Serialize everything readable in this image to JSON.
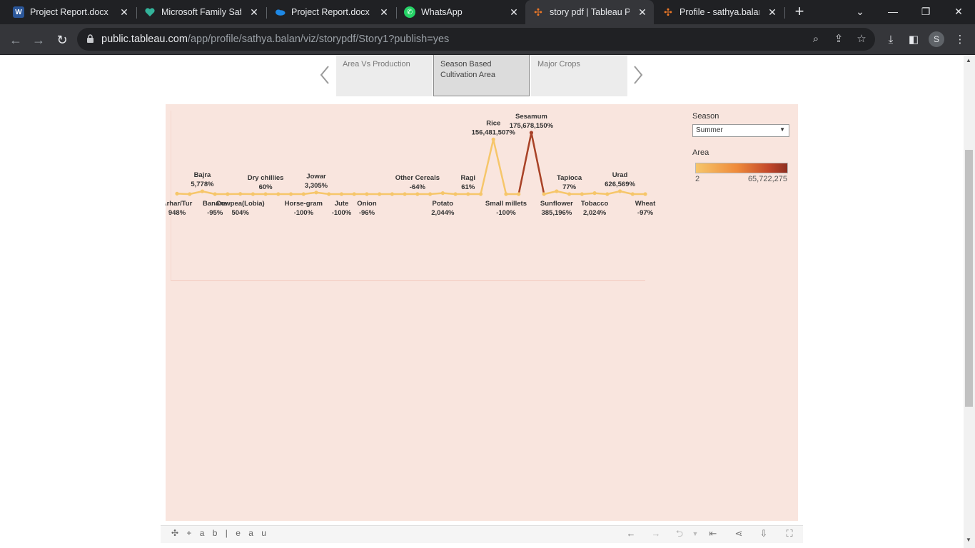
{
  "browser": {
    "tabs": [
      {
        "title": "Project Report.docx -",
        "icon": "word-icon",
        "active": false
      },
      {
        "title": "Microsoft Family Safe",
        "icon": "family-safety-icon",
        "active": false
      },
      {
        "title": "Project Report.docx -",
        "icon": "onedrive-icon",
        "active": false
      },
      {
        "title": "WhatsApp",
        "icon": "whatsapp-icon",
        "active": false
      },
      {
        "title": "story pdf | Tableau Pu",
        "icon": "tableau-icon",
        "active": true
      },
      {
        "title": "Profile - sathya.balan",
        "icon": "tableau-icon",
        "active": false
      }
    ],
    "url_host": "public.tableau.com",
    "url_path": "/app/profile/sathya.balan/viz/storypdf/Story1?publish=yes",
    "profile_initial": "S"
  },
  "story": {
    "tabs": [
      {
        "label": "Area Vs Production",
        "selected": false
      },
      {
        "label": "Season Based Cultivation Area",
        "selected": true
      },
      {
        "label": "Major Crops",
        "selected": false
      }
    ]
  },
  "filter": {
    "title": "Season",
    "value": "Summer"
  },
  "legend": {
    "title": "Area",
    "min": "2",
    "max": "65,722,275",
    "colors": [
      "#f6c66a",
      "#ef8a3a",
      "#c3472a",
      "#8e2f21"
    ]
  },
  "chart_data": {
    "type": "line",
    "series_note": "",
    "categories": [
      "Arhar/Tur",
      "",
      "Bajra",
      "Banana",
      "",
      "Cowpea(Lobia)",
      "",
      "Dry chillies",
      "",
      "",
      "Horse-gram",
      "Jowar",
      "",
      "Jute",
      "",
      "Onion",
      "",
      "",
      "",
      "Other Cereals",
      "",
      "Potato",
      "",
      "Ragi",
      "",
      "Rice",
      "Small millets",
      "",
      "Sesamum",
      "",
      "Sunflower",
      "Tapioca",
      "",
      "Tobacco",
      "",
      "Urad",
      "",
      "Wheat"
    ],
    "values": [
      948,
      null,
      5778,
      -95,
      null,
      504,
      null,
      60,
      null,
      null,
      -100,
      3305,
      null,
      -100,
      null,
      -96,
      null,
      null,
      null,
      -64,
      null,
      2044,
      null,
      61,
      null,
      156481507,
      -100,
      null,
      175678150,
      null,
      385196,
      77,
      null,
      2024,
      null,
      626569,
      null,
      -97
    ],
    "labels": [
      {
        "name": "Arhar/Tur",
        "value": "948%",
        "pos": "below"
      },
      {
        "name": "Bajra",
        "value": "5,778%",
        "pos": "above"
      },
      {
        "name": "Banana",
        "value": "-95%",
        "pos": "below"
      },
      {
        "name": "Cowpea(Lobia)",
        "value": "504%",
        "pos": "below"
      },
      {
        "name": "Dry chillies",
        "value": "60%",
        "pos": "above"
      },
      {
        "name": "Horse-gram",
        "value": "-100%",
        "pos": "below"
      },
      {
        "name": "Jowar",
        "value": "3,305%",
        "pos": "above"
      },
      {
        "name": "Jute",
        "value": "-100%",
        "pos": "below"
      },
      {
        "name": "Onion",
        "value": "-96%",
        "pos": "below"
      },
      {
        "name": "Other Cereals",
        "value": "-64%",
        "pos": "above"
      },
      {
        "name": "Potato",
        "value": "2,044%",
        "pos": "below"
      },
      {
        "name": "Ragi",
        "value": "61%",
        "pos": "above"
      },
      {
        "name": "Rice",
        "value": "156,481,507%",
        "pos": "above"
      },
      {
        "name": "Small millets",
        "value": "-100%",
        "pos": "below"
      },
      {
        "name": "Sesamum",
        "value": "175,678,150%",
        "pos": "above"
      },
      {
        "name": "Sunflower",
        "value": "385,196%",
        "pos": "below"
      },
      {
        "name": "Tapioca",
        "value": "77%",
        "pos": "above"
      },
      {
        "name": "Tobacco",
        "value": "2,024%",
        "pos": "below"
      },
      {
        "name": "Urad",
        "value": "626,569%",
        "pos": "above"
      },
      {
        "name": "Wheat",
        "value": "-97%",
        "pos": "below"
      }
    ],
    "line_color": "#f6c66a",
    "peak_color": "#a8422a",
    "grid": false,
    "legend": "right"
  },
  "tableau_bar": {
    "logo": "+ a b | e a u"
  }
}
